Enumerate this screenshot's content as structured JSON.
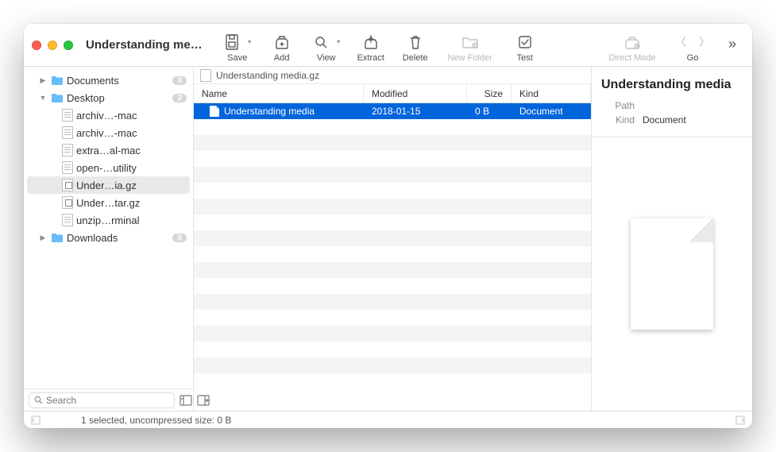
{
  "window": {
    "title": "Understanding me…"
  },
  "toolbar": {
    "save": "Save",
    "add": "Add",
    "view": "View",
    "extract": "Extract",
    "delete": "Delete",
    "new_folder": "New Folder",
    "test": "Test",
    "direct_mode": "Direct Mode",
    "go": "Go"
  },
  "sidebar": {
    "items": [
      {
        "label": "Documents",
        "badge": "0",
        "expandable": true,
        "expanded": false,
        "depth": 1,
        "type": "folder"
      },
      {
        "label": "Desktop",
        "badge": "2",
        "expandable": true,
        "expanded": true,
        "depth": 1,
        "type": "folder"
      },
      {
        "label": "archiv…-mac",
        "depth": 2,
        "type": "txt"
      },
      {
        "label": "archiv…-mac",
        "depth": 2,
        "type": "txt"
      },
      {
        "label": "extra…al-mac",
        "depth": 2,
        "type": "txt"
      },
      {
        "label": "open-…utility",
        "depth": 2,
        "type": "txt"
      },
      {
        "label": "Under…ia.gz",
        "depth": 2,
        "type": "arch",
        "selected": true
      },
      {
        "label": "Under…tar.gz",
        "depth": 2,
        "type": "arch"
      },
      {
        "label": "unzip…rminal",
        "depth": 2,
        "type": "txt"
      },
      {
        "label": "Downloads",
        "badge": "0",
        "expandable": true,
        "expanded": false,
        "depth": 1,
        "type": "folder"
      }
    ],
    "search_placeholder": "Search"
  },
  "breadcrumb": "Understanding media.gz",
  "columns": {
    "name": "Name",
    "modified": "Modified",
    "size": "Size",
    "kind": "Kind"
  },
  "rows": [
    {
      "name": "Understanding media",
      "modified": "2018-01-15",
      "size": "0 B",
      "kind": "Document",
      "selected": true
    }
  ],
  "preview": {
    "title": "Understanding media",
    "path_label": "Path",
    "path_value": "",
    "kind_label": "Kind",
    "kind_value": "Document"
  },
  "status": "1 selected, uncompressed size: 0 B"
}
